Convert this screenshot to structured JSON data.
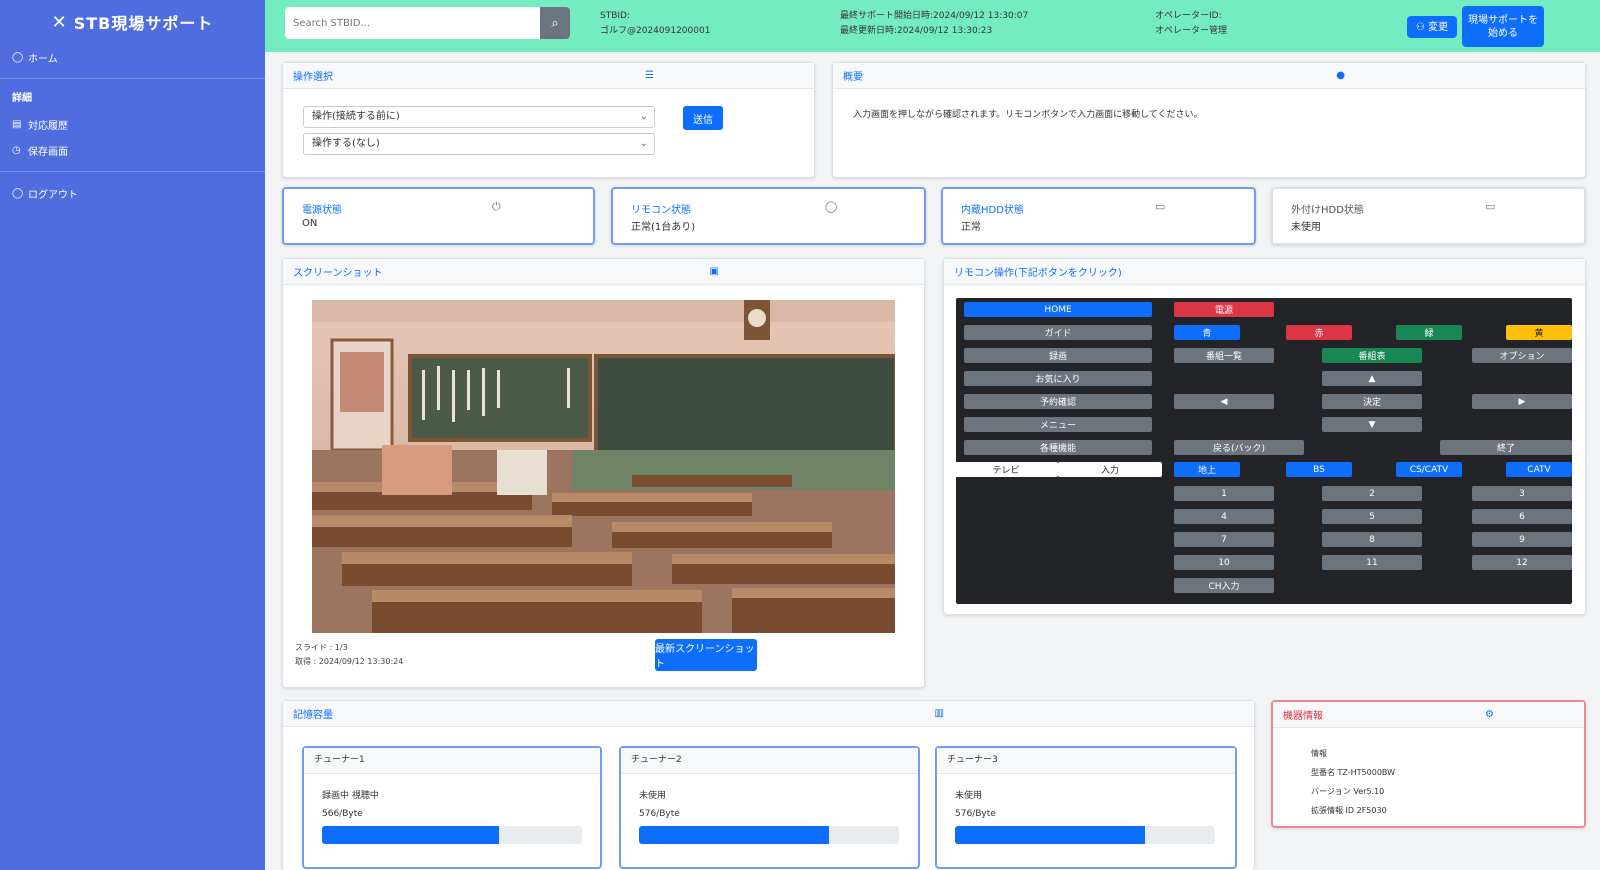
{
  "sidebar": {
    "brand": "STB現場サポート",
    "logo_icon": "✕",
    "home": "ホーム",
    "section": "詳細",
    "item1": "対応履歴",
    "item2": "保存画面",
    "logout": "ログアウト"
  },
  "topbar": {
    "search_placeholder": "Search STBID...",
    "stb_id_label": "STBID:",
    "stb_id_value": "ゴルフ@2024091200001",
    "last_support": "最終サポート開始日時:2024/09/12 13:30:07",
    "last_change": "最終更新日時:2024/09/12 13:30:23",
    "operator_label": "オペレーターID:",
    "operator_value": "オペレーター管理",
    "btn_change": "変更",
    "btn_start": "現場サポートを\n始める"
  },
  "pane_select": {
    "title": "操作選択",
    "select1": "操作(接続する前に)",
    "select2": "操作する(なし)",
    "submit": "送信"
  },
  "notice": {
    "title": "概要",
    "text": "入力画面を押しながら確認されます。リモコンボタンで入力画面に移動してください。"
  },
  "stats": [
    {
      "label": "電源状態",
      "value": "ON",
      "icon": "⏻"
    },
    {
      "label": "リモコン状態",
      "value": "正常(1台あり)",
      "icon": "◯"
    },
    {
      "label": "内蔵HDD状態",
      "value": "正常",
      "icon": "▭"
    },
    {
      "label": "外付けHDD状態",
      "value": "未使用",
      "icon": "▭"
    }
  ],
  "screenshot": {
    "title": "スクリーンショット",
    "capture_label": "スライド : 1/3",
    "capture_time": "取得 : 2024/09/12 13:30:24",
    "btn": "最新スクリーンショット"
  },
  "remote": {
    "title": "リモコン操作(下記ボタンをクリック)",
    "rows": [
      {
        "name": "remote-home",
        "label": "HOME"
      },
      {
        "name": "remote-power",
        "label": "電源"
      },
      {
        "name": "remote-guide",
        "label": "ガイド"
      },
      {
        "name": "remote-blue",
        "label": "青"
      },
      {
        "name": "remote-red",
        "label": "赤"
      },
      {
        "name": "remote-green",
        "label": "緑"
      },
      {
        "name": "remote-yellow",
        "label": "黄"
      },
      {
        "name": "remote-record",
        "label": "録画"
      },
      {
        "name": "remote-playlist",
        "label": "番組一覧"
      },
      {
        "name": "remote-epg",
        "label": "番組表"
      },
      {
        "name": "remote-option",
        "label": "オプション"
      },
      {
        "name": "remote-favorite",
        "label": "お気に入り"
      },
      {
        "name": "remote-up",
        "label": "▲"
      },
      {
        "name": "remote-timer",
        "label": "予約確認"
      },
      {
        "name": "remote-left",
        "label": "◀"
      },
      {
        "name": "remote-ok",
        "label": "決定"
      },
      {
        "name": "remote-right",
        "label": "▶"
      },
      {
        "name": "remote-menu",
        "label": "メニュー"
      },
      {
        "name": "remote-down",
        "label": "▼"
      },
      {
        "name": "remote-settings",
        "label": "各種機能"
      },
      {
        "name": "remote-back",
        "label": "戻る(バック)"
      },
      {
        "name": "remote-exit",
        "label": "終了"
      },
      {
        "name": "remote-tv",
        "label": "テレビ"
      },
      {
        "name": "remote-input",
        "label": "入力"
      },
      {
        "name": "remote-digital",
        "label": "地上"
      },
      {
        "name": "remote-bs",
        "label": "BS"
      },
      {
        "name": "remote-cs",
        "label": "CS/CATV"
      },
      {
        "name": "remote-catv",
        "label": "CATV"
      },
      {
        "name": "remote-1",
        "label": "1"
      },
      {
        "name": "remote-2",
        "label": "2"
      },
      {
        "name": "remote-3",
        "label": "3"
      },
      {
        "name": "remote-4",
        "label": "4"
      },
      {
        "name": "remote-5",
        "label": "5"
      },
      {
        "name": "remote-6",
        "label": "6"
      },
      {
        "name": "remote-7",
        "label": "7"
      },
      {
        "name": "remote-8",
        "label": "8"
      },
      {
        "name": "remote-9",
        "label": "9"
      },
      {
        "name": "remote-10",
        "label": "10"
      },
      {
        "name": "remote-11",
        "label": "11"
      },
      {
        "name": "remote-12",
        "label": "12"
      },
      {
        "name": "remote-ch-input",
        "label": "CH入力"
      }
    ]
  },
  "storage": {
    "title": "記憶容量",
    "cards": [
      {
        "title": "チューナー1",
        "status": "録画中 視聴中",
        "size": "566/Byte",
        "fill": 0.68
      },
      {
        "title": "チューナー2",
        "status": "未使用",
        "size": "576/Byte",
        "fill": 0.73
      },
      {
        "title": "チューナー3",
        "status": "未使用",
        "size": "576/Byte",
        "fill": 0.73
      }
    ]
  },
  "device": {
    "title": "機器情報",
    "rows": [
      "情報",
      "型番名    TZ-HT5000BW",
      "バージョン    Ver5.10",
      "拡張情報    ID 2F5030"
    ]
  },
  "colors": {
    "sidebar": "#4f6ddf",
    "topbar": "#74ecc2",
    "accent": "#0d6efd"
  }
}
